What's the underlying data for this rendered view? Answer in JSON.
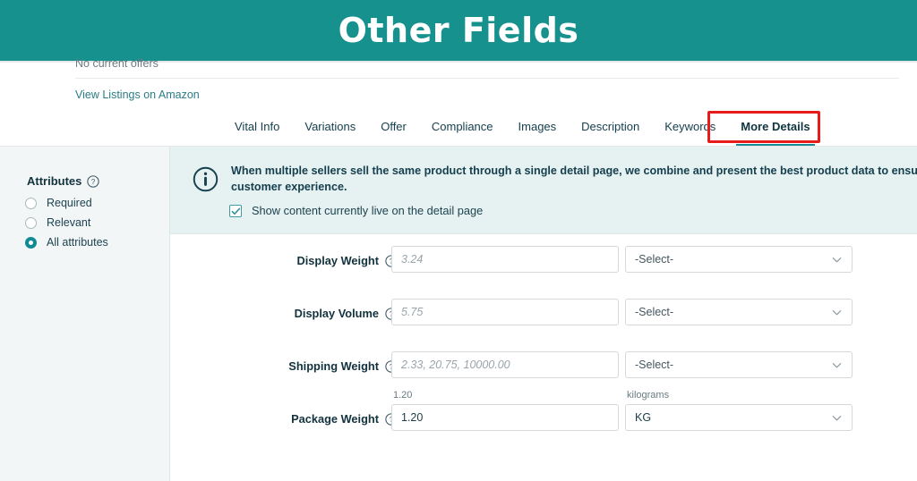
{
  "banner": {
    "title": "Other Fields",
    "bg_color": "#16918E",
    "text_color": "#FFFFFF"
  },
  "page_top": {
    "offers_text": "No current offers",
    "view_listings_link": "View Listings on Amazon"
  },
  "tabs": {
    "items": [
      {
        "label": "Vital Info",
        "active": false
      },
      {
        "label": "Variations",
        "active": false
      },
      {
        "label": "Offer",
        "active": false
      },
      {
        "label": "Compliance",
        "active": false
      },
      {
        "label": "Images",
        "active": false
      },
      {
        "label": "Description",
        "active": false
      },
      {
        "label": "Keywords",
        "active": false
      },
      {
        "label": "More Details",
        "active": true
      }
    ],
    "active_underline_color": "#178A94",
    "highlight_color": "#E81B1B"
  },
  "sidebar": {
    "heading": "Attributes",
    "help_icon": "question-circle-icon",
    "options": [
      {
        "label": "Required",
        "selected": false
      },
      {
        "label": "Relevant",
        "selected": false
      },
      {
        "label": "All attributes",
        "selected": true
      }
    ],
    "selected_color": "#128A92"
  },
  "info_banner": {
    "icon": "info-circle-icon",
    "message": "When multiple sellers sell the same product through a single detail page, we combine and present the best product data to ensure customer experience.",
    "checkbox": {
      "label": "Show content currently live on the detail page",
      "checked": true,
      "color": "#3F9CA4"
    },
    "bg_color": "#E6F1F1"
  },
  "form": {
    "rows": [
      {
        "label": "Display Weight",
        "help_icon": "question-circle-icon",
        "input_value": "3.24",
        "input_is_placeholder": true,
        "input_sub_label": "",
        "select_value": "-Select-",
        "select_is_placeholder": true,
        "select_sub_label": ""
      },
      {
        "label": "Display Volume",
        "help_icon": "question-circle-icon",
        "input_value": "5.75",
        "input_is_placeholder": true,
        "input_sub_label": "",
        "select_value": "-Select-",
        "select_is_placeholder": true,
        "select_sub_label": ""
      },
      {
        "label": "Shipping Weight",
        "help_icon": "question-circle-icon",
        "input_value": "2.33, 20.75, 10000.00",
        "input_is_placeholder": true,
        "input_sub_label": "",
        "select_value": "-Select-",
        "select_is_placeholder": true,
        "select_sub_label": ""
      },
      {
        "label": "Package Weight",
        "help_icon": "question-circle-icon",
        "input_value": "1.20",
        "input_is_placeholder": false,
        "input_sub_label": "1.20",
        "select_value": "KG",
        "select_is_placeholder": false,
        "select_sub_label": "kilograms"
      }
    ]
  }
}
